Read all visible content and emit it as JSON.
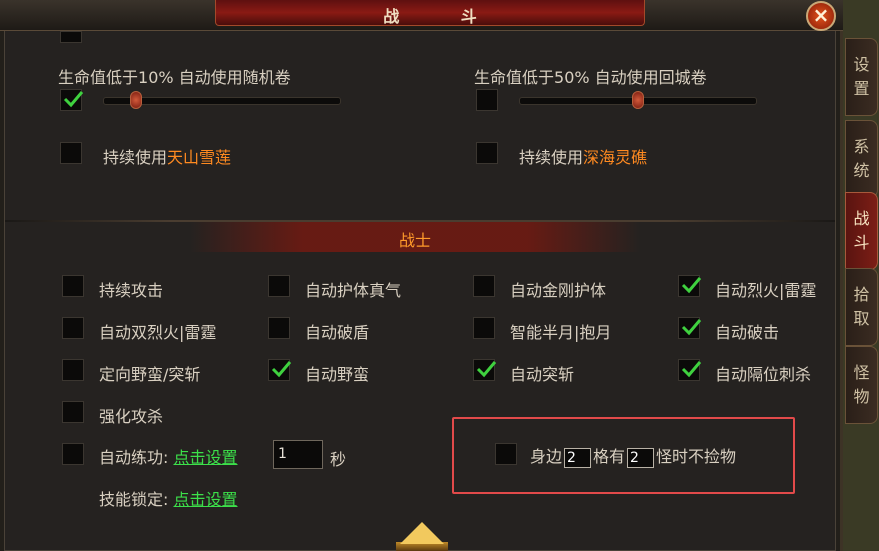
{
  "window": {
    "title": "战 斗",
    "close_glyph": "×"
  },
  "top_section": {
    "hp_random": {
      "label_prefix": "生命值低于",
      "threshold": "10%",
      "label_suffix": " 自动使用随机卷",
      "checked": true,
      "slider_value_fraction": 0.1
    },
    "hp_return": {
      "label_prefix": "生命值低于",
      "threshold": "50%",
      "label_suffix": " 自动使用回城卷",
      "checked": false,
      "slider_value_fraction": 0.5
    },
    "use_snow_lotus": {
      "label_prefix": "持续使用",
      "item": "天山雪莲",
      "checked": false
    },
    "use_sea_reishi": {
      "label_prefix": "持续使用",
      "item": "深海灵礁",
      "checked": false
    }
  },
  "warrior_section": {
    "title": "战士",
    "options": [
      {
        "label": "持续攻击",
        "checked": false
      },
      {
        "label": "自动护体真气",
        "checked": false
      },
      {
        "label": "自动金刚护体",
        "checked": false
      },
      {
        "label": "自动烈火|雷霆",
        "checked": true
      },
      {
        "label": "自动双烈火|雷霆",
        "checked": false
      },
      {
        "label": "自动破盾",
        "checked": false
      },
      {
        "label": "智能半月|抱月",
        "checked": false
      },
      {
        "label": "自动破击",
        "checked": true
      },
      {
        "label": "定向野蛮/突斩",
        "checked": false
      },
      {
        "label": "自动野蛮",
        "checked": true
      },
      {
        "label": "自动突斩",
        "checked": true
      },
      {
        "label": "自动隔位刺杀",
        "checked": true
      },
      {
        "label": "强化攻杀",
        "checked": false
      }
    ],
    "auto_practice": {
      "label": "自动练功: ",
      "link": "点击设置",
      "value": "1",
      "unit": "秒",
      "checked": false
    },
    "skill_lock": {
      "label": "技能锁定: ",
      "link": "点击设置"
    },
    "no_pickup": {
      "checked": false,
      "text1": "身边",
      "value1": "2",
      "text2": "格有",
      "value2": "2",
      "text3": "怪时不捡物"
    }
  },
  "side_tabs": [
    {
      "label": "设置",
      "active": false
    },
    {
      "label": "系统",
      "active": false
    },
    {
      "label": "战斗",
      "active": true
    },
    {
      "label": "拾取",
      "active": false
    },
    {
      "label": "怪物",
      "active": false
    }
  ],
  "colors": {
    "accent_orange": "#ff8a20",
    "link_green": "#3ce04a",
    "check_green": "#3fd13f",
    "highlight_red": "#e24a4a"
  },
  "icons": {
    "close": "close-icon",
    "check": "checkmark-icon",
    "expand": "arrow-up-icon"
  }
}
